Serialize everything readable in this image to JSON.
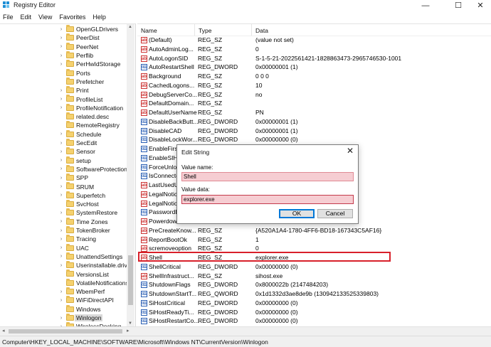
{
  "window": {
    "title": "Registry Editor",
    "minimize": "—",
    "maximize": "☐",
    "close": "✕"
  },
  "menu": [
    "File",
    "Edit",
    "View",
    "Favorites",
    "Help"
  ],
  "tree": {
    "items": [
      {
        "label": "OpenGLDrivers",
        "expander": "›"
      },
      {
        "label": "PeerDist",
        "expander": "›"
      },
      {
        "label": "PeerNet",
        "expander": "›"
      },
      {
        "label": "Perflib",
        "expander": "›"
      },
      {
        "label": "PerHwIdStorage",
        "expander": "›"
      },
      {
        "label": "Ports",
        "expander": ""
      },
      {
        "label": "Prefetcher",
        "expander": ""
      },
      {
        "label": "Print",
        "expander": "›"
      },
      {
        "label": "ProfileList",
        "expander": "›"
      },
      {
        "label": "ProfileNotification",
        "expander": "›"
      },
      {
        "label": "related.desc",
        "expander": ""
      },
      {
        "label": "RemoteRegistry",
        "expander": ""
      },
      {
        "label": "Schedule",
        "expander": "›"
      },
      {
        "label": "SecEdit",
        "expander": "›"
      },
      {
        "label": "Sensor",
        "expander": "›"
      },
      {
        "label": "setup",
        "expander": "›"
      },
      {
        "label": "SoftwareProtectionPl",
        "expander": "›"
      },
      {
        "label": "SPP",
        "expander": "›"
      },
      {
        "label": "SRUM",
        "expander": "›"
      },
      {
        "label": "Superfetch",
        "expander": "›"
      },
      {
        "label": "SvcHost",
        "expander": ""
      },
      {
        "label": "SystemRestore",
        "expander": "›"
      },
      {
        "label": "Time Zones",
        "expander": "›"
      },
      {
        "label": "TokenBroker",
        "expander": "›"
      },
      {
        "label": "Tracing",
        "expander": "›"
      },
      {
        "label": "UAC",
        "expander": "›"
      },
      {
        "label": "UnattendSettings",
        "expander": "›"
      },
      {
        "label": "Userinstallable.drive",
        "expander": "›"
      },
      {
        "label": "VersionsList",
        "expander": ""
      },
      {
        "label": "VolatileNotifications",
        "expander": ""
      },
      {
        "label": "WbemPerf",
        "expander": "›"
      },
      {
        "label": "WiFiDirectAPI",
        "expander": "›"
      },
      {
        "label": "Windows",
        "expander": ""
      },
      {
        "label": "Winlogon",
        "expander": "›",
        "selected": true
      },
      {
        "label": "WirelessDocking",
        "expander": "›"
      }
    ]
  },
  "list": {
    "headers": {
      "name": "Name",
      "type": "Type",
      "data": "Data"
    },
    "rows": [
      {
        "icon": "sz",
        "name": "(Default)",
        "type": "REG_SZ",
        "data": "(value not set)"
      },
      {
        "icon": "sz",
        "name": "AutoAdminLog...",
        "type": "REG_SZ",
        "data": "0"
      },
      {
        "icon": "sz",
        "name": "AutoLogonSID",
        "type": "REG_SZ",
        "data": "S-1-5-21-2022561421-1828863473-2965746530-1001"
      },
      {
        "icon": "bin",
        "name": "AutoRestartShell",
        "type": "REG_DWORD",
        "data": "0x00000001 (1)"
      },
      {
        "icon": "sz",
        "name": "Background",
        "type": "REG_SZ",
        "data": "0 0 0"
      },
      {
        "icon": "sz",
        "name": "CachedLogons...",
        "type": "REG_SZ",
        "data": "10"
      },
      {
        "icon": "sz",
        "name": "DebugServerCo...",
        "type": "REG_SZ",
        "data": "no"
      },
      {
        "icon": "sz",
        "name": "DefaultDomain...",
        "type": "REG_SZ",
        "data": ""
      },
      {
        "icon": "sz",
        "name": "DefaultUserName",
        "type": "REG_SZ",
        "data": "PN"
      },
      {
        "icon": "bin",
        "name": "DisableBackButt...",
        "type": "REG_DWORD",
        "data": "0x00000001 (1)"
      },
      {
        "icon": "bin",
        "name": "DisableCAD",
        "type": "REG_DWORD",
        "data": "0x00000001 (1)"
      },
      {
        "icon": "bin",
        "name": "DisableLockWor...",
        "type": "REG_DWORD",
        "data": "0x00000000 (0)"
      },
      {
        "icon": "bin",
        "name": "EnableFirst",
        "type": "",
        "data": ""
      },
      {
        "icon": "bin",
        "name": "EnableSIHo",
        "type": "",
        "data": ""
      },
      {
        "icon": "bin",
        "name": "ForceUnloc",
        "type": "",
        "data": ""
      },
      {
        "icon": "bin",
        "name": "IsConnecte",
        "type": "",
        "data": ""
      },
      {
        "icon": "sz",
        "name": "LastUsedU",
        "type": "",
        "data": ""
      },
      {
        "icon": "sz",
        "name": "LegalNotic",
        "type": "",
        "data": ""
      },
      {
        "icon": "sz",
        "name": "LegalNotic",
        "type": "",
        "data": ""
      },
      {
        "icon": "bin",
        "name": "PasswordE",
        "type": "",
        "data": ""
      },
      {
        "icon": "sz",
        "name": "Powerdow",
        "type": "",
        "data": ""
      },
      {
        "icon": "sz",
        "name": "PreCreateKnow...",
        "type": "REG_SZ",
        "data": "{A520A1A4-1780-4FF6-BD18-167343C5AF16}"
      },
      {
        "icon": "sz",
        "name": "ReportBootOk",
        "type": "REG_SZ",
        "data": "1"
      },
      {
        "icon": "sz",
        "name": "scremoveoption",
        "type": "REG_SZ",
        "data": "0"
      },
      {
        "icon": "sz",
        "name": "Shell",
        "type": "REG_SZ",
        "data": "explorer.exe"
      },
      {
        "icon": "bin",
        "name": "ShellCritical",
        "type": "REG_DWORD",
        "data": "0x00000000 (0)"
      },
      {
        "icon": "sz",
        "name": "ShellInfrastruct...",
        "type": "REG_SZ",
        "data": "sihost.exe"
      },
      {
        "icon": "bin",
        "name": "ShutdownFlags",
        "type": "REG_DWORD",
        "data": "0x8000022b (2147484203)"
      },
      {
        "icon": "bin",
        "name": "ShutdownStartT...",
        "type": "REG_QWORD",
        "data": "0x1d1332d3ae8de9b (130942133525339803)"
      },
      {
        "icon": "bin",
        "name": "SiHostCritical",
        "type": "REG_DWORD",
        "data": "0x00000000 (0)"
      },
      {
        "icon": "bin",
        "name": "SiHostReadyTi...",
        "type": "REG_DWORD",
        "data": "0x00000000 (0)"
      },
      {
        "icon": "bin",
        "name": "SiHostRestartCo...",
        "type": "REG_DWORD",
        "data": "0x00000000 (0)"
      },
      {
        "icon": "bin",
        "name": "SiHostRestartTi...",
        "type": "REG_DWORD",
        "data": "0x00000000 (0)"
      }
    ]
  },
  "dialog": {
    "title": "Edit String",
    "close": "✕",
    "value_name_label": "Value name:",
    "value_name": "Shell",
    "value_data_label": "Value data:",
    "value_data": "explorer.exe",
    "ok": "OK",
    "cancel": "Cancel"
  },
  "status": {
    "path": "Computer\\HKEY_LOCAL_MACHINE\\SOFTWARE\\Microsoft\\Windows NT\\CurrentVersion\\Winlogon"
  },
  "colors": {
    "highlight": "#d8202a",
    "dialog_field": "#f6cdd2",
    "folder": "#f5d16f"
  }
}
